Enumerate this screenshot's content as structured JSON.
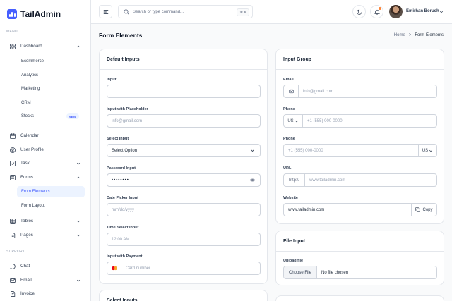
{
  "app": {
    "name": "TailAdmin"
  },
  "sidebar": {
    "menu_label": "MENU",
    "support_label": "SUPPORT",
    "items": [
      {
        "label": "Dashboard",
        "icon": "grid-icon"
      },
      {
        "label": "Calendar",
        "icon": "calendar-icon"
      },
      {
        "label": "User Profile",
        "icon": "user-circle-icon"
      },
      {
        "label": "Task",
        "icon": "checklist-icon"
      },
      {
        "label": "Forms",
        "icon": "form-icon"
      },
      {
        "label": "Tables",
        "icon": "table-icon"
      },
      {
        "label": "Pages",
        "icon": "pages-icon"
      }
    ],
    "dashboard_sub": [
      "Ecommerce",
      "Analytics",
      "Marketing",
      "CRM",
      "Stocks"
    ],
    "stocks_badge": "NEW",
    "forms_sub": [
      "From Elements",
      "Form Layout"
    ],
    "support_items": [
      {
        "label": "Chat",
        "icon": "chat-icon"
      },
      {
        "label": "Email",
        "icon": "mail-icon"
      },
      {
        "label": "Invoice",
        "icon": "invoice-icon"
      }
    ]
  },
  "header": {
    "search_placeholder": "Search or type command...",
    "search_shortcut": "⌘ K",
    "user_name": "Emirhan Boruch"
  },
  "page": {
    "title": "Form Elements",
    "breadcrumb": [
      "Home",
      ">",
      "Form Elements"
    ]
  },
  "default_inputs": {
    "title": "Default Inputs",
    "input_label": "Input",
    "placeholder_label": "Input with Placeholder",
    "placeholder_value": "info@gmail.com",
    "select_label": "Select Input",
    "select_value": "Select Option",
    "password_label": "Password Input",
    "password_value": "••••••••",
    "date_label": "Date Picker Input",
    "date_placeholder": "mm/dd/yyyy",
    "time_label": "Time Select Input",
    "time_placeholder": "12:00 AM",
    "payment_label": "Input with Payment",
    "payment_placeholder": "Card number"
  },
  "input_group": {
    "title": "Input Group",
    "email_label": "Email",
    "email_placeholder": "info@gmail.com",
    "phone_label": "Phone",
    "phone_country": "US",
    "phone_placeholder": "+1 (555) 000-0000",
    "phone2_label": "Phone",
    "phone2_placeholder": "+1 (555) 000-0000",
    "phone2_country": "US",
    "url_label": "URL",
    "url_prefix": "http://",
    "url_placeholder": "www.tailadmin.com",
    "website_label": "Website",
    "website_value": "www.tailadmin.com",
    "copy_label": "Copy"
  },
  "file_input": {
    "title": "File Input",
    "upload_label": "Upload file",
    "button_label": "Choose File",
    "status": "No file chosen"
  },
  "select_inputs": {
    "title": "Select Inputs"
  },
  "colors": {
    "accent": "#465fff",
    "accent_bg": "#ecf3ff",
    "notif": "#fd853a"
  }
}
